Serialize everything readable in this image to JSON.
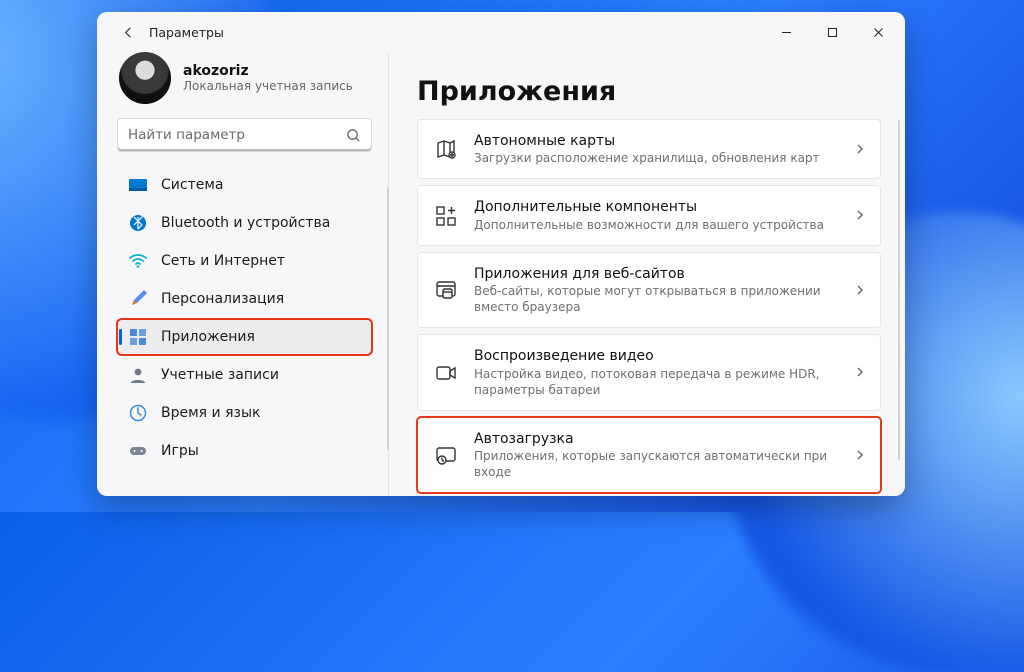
{
  "window": {
    "title": "Параметры"
  },
  "user": {
    "name": "akozoriz",
    "sub": "Локальная учетная запись"
  },
  "search": {
    "placeholder": "Найти параметр"
  },
  "sidebar": {
    "items": [
      {
        "label": "Система"
      },
      {
        "label": "Bluetooth и устройства"
      },
      {
        "label": "Сеть и Интернет"
      },
      {
        "label": "Персонализация"
      },
      {
        "label": "Приложения"
      },
      {
        "label": "Учетные записи"
      },
      {
        "label": "Время и язык"
      },
      {
        "label": "Игры"
      }
    ]
  },
  "main": {
    "title": "Приложения",
    "cards": [
      {
        "title": "Автономные карты",
        "sub": "Загрузки расположение хранилища, обновления карт"
      },
      {
        "title": "Дополнительные компоненты",
        "sub": "Дополнительные возможности для вашего устройства"
      },
      {
        "title": "Приложения для веб-сайтов",
        "sub": "Веб-сайты, которые могут открываться в приложении вместо браузера"
      },
      {
        "title": "Воспроизведение видео",
        "sub": "Настройка видео, потоковая передача в режиме HDR, параметры батареи"
      },
      {
        "title": "Автозагрузка",
        "sub": "Приложения, которые запускаются автоматически при входе"
      }
    ]
  }
}
